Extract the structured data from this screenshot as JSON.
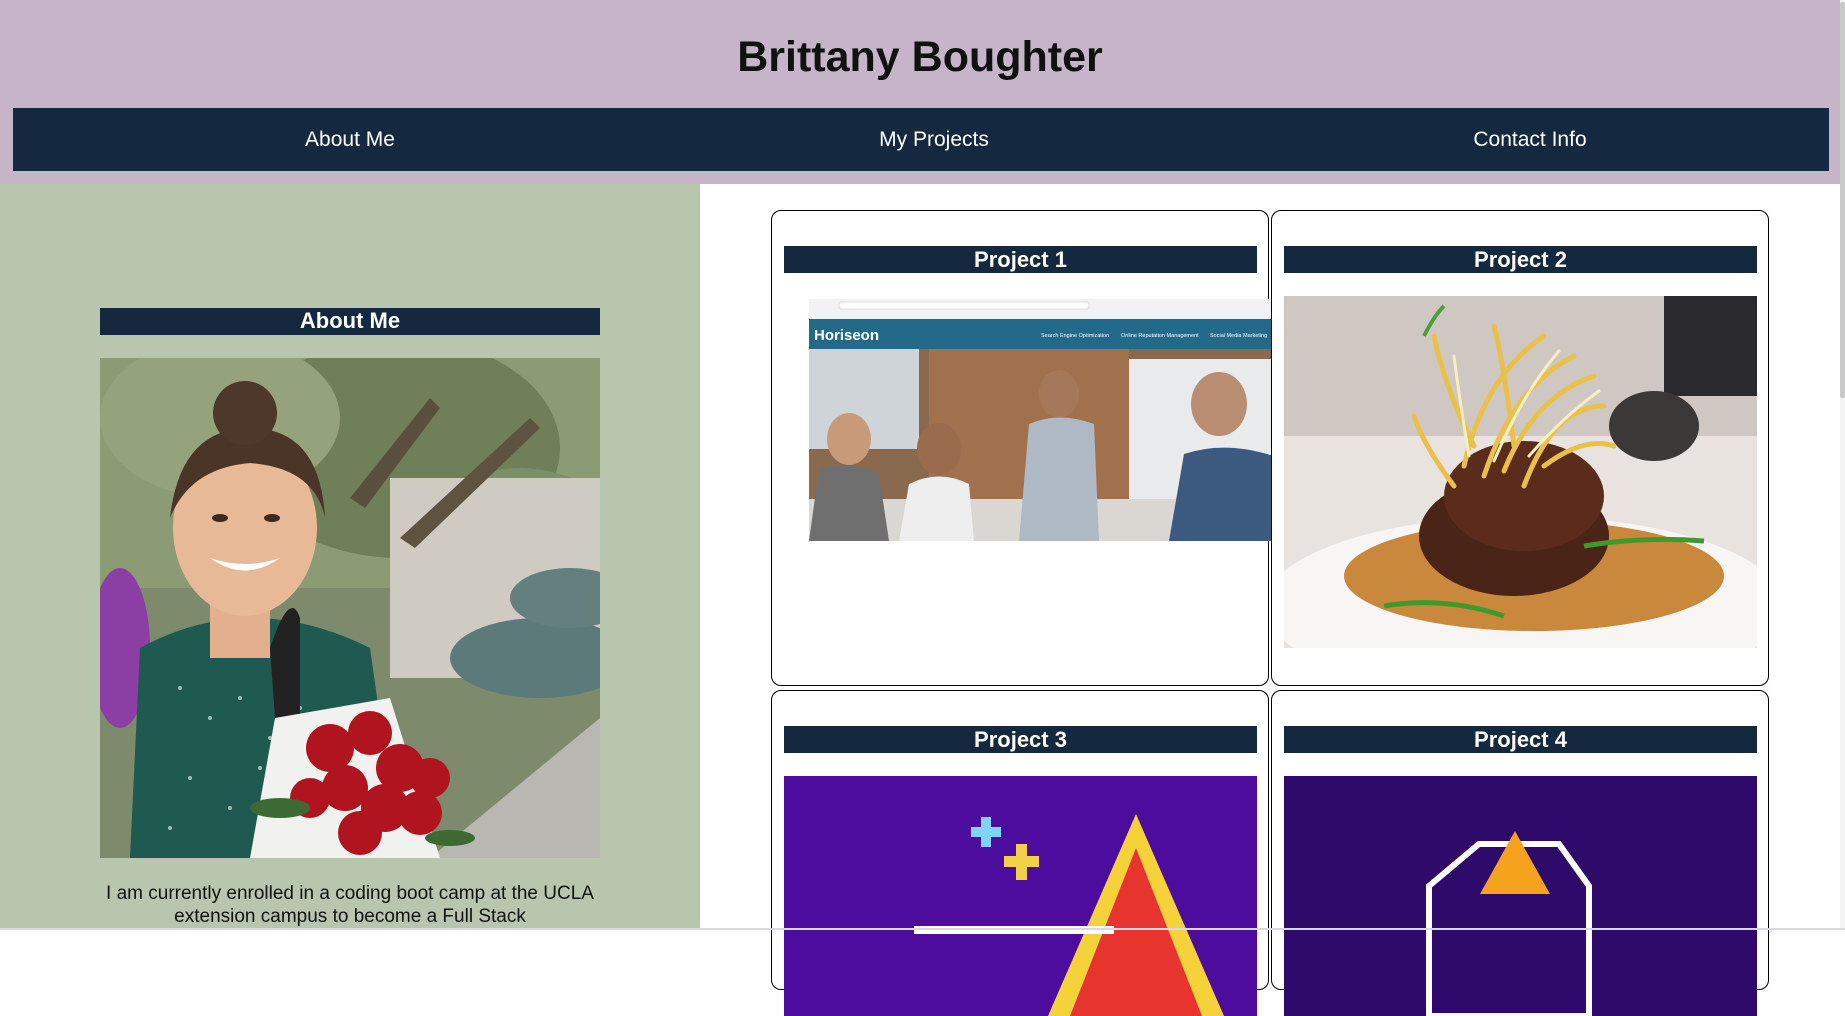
{
  "header": {
    "title": "Brittany Boughter"
  },
  "nav": {
    "items": [
      "About Me",
      "My Projects",
      "Contact Info"
    ]
  },
  "about": {
    "heading": "About Me",
    "text": "I am currently enrolled in a coding boot camp at the UCLA extension campus to become a Full Stack"
  },
  "projects": [
    {
      "title": "Project 1",
      "shot": {
        "brand": "Horiseon",
        "links": [
          "Search Engine Optimization",
          "Online Reputation Management",
          "Social Media Marketing"
        ]
      }
    },
    {
      "title": "Project 2"
    },
    {
      "title": "Project 3"
    },
    {
      "title": "Project 4"
    }
  ],
  "colors": {
    "header_bg": "#c6b4c9",
    "nav_bg": "#142840",
    "about_bg": "#b8c6ad",
    "card_border": "#000000",
    "project3_bg": "#4e0c9e",
    "project4_bg": "#2e0a6b"
  }
}
